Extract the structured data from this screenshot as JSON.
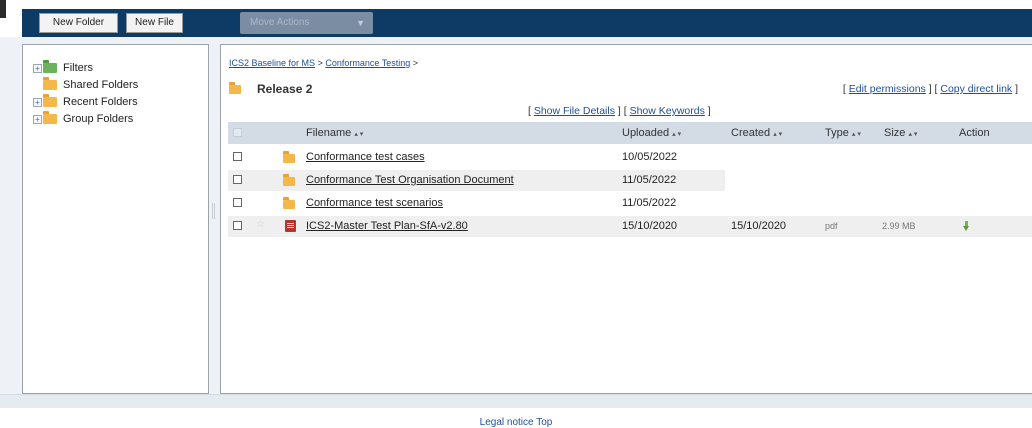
{
  "toolbar": {
    "new_folder": "New Folder",
    "new_file": "New File",
    "move_actions": "Move Actions"
  },
  "sidebar": {
    "items": [
      {
        "label": "Filters",
        "expandable": true,
        "icon": "folder-green-icon"
      },
      {
        "label": "Shared Folders",
        "expandable": false,
        "icon": "folder-icon"
      },
      {
        "label": "Recent Folders",
        "expandable": true,
        "icon": "folder-icon"
      },
      {
        "label": "Group Folders",
        "expandable": true,
        "icon": "folder-icon"
      }
    ]
  },
  "breadcrumb": {
    "items": [
      "ICS2 Baseline for MS",
      "Conformance Testing"
    ],
    "separator": ">"
  },
  "folder": {
    "title": "Release 2"
  },
  "links": {
    "edit_permissions": "Edit permissions",
    "copy_direct_link": "Copy direct link",
    "show_file_details": "Show File Details",
    "show_keywords": "Show Keywords"
  },
  "table": {
    "columns": [
      "Filename",
      "Uploaded",
      "Created",
      "Type",
      "Size",
      "Action"
    ],
    "rows": [
      {
        "name": "Conformance test cases",
        "uploaded": "10/05/2022",
        "created": "",
        "type": "",
        "size": "",
        "kind": "folder"
      },
      {
        "name": "Conformance Test Organisation Document",
        "uploaded": "11/05/2022",
        "created": "",
        "type": "",
        "size": "",
        "kind": "folder"
      },
      {
        "name": "Conformance test scenarios",
        "uploaded": "11/05/2022",
        "created": "",
        "type": "",
        "size": "",
        "kind": "folder"
      },
      {
        "name": "ICS2-Master Test Plan-SfA-v2.80",
        "uploaded": "15/10/2020",
        "created": "15/10/2020",
        "type": "pdf",
        "size": "2.99 MB",
        "kind": "pdf"
      }
    ]
  },
  "footer": {
    "legal": "Legal notice",
    "top": "Top"
  },
  "colors": {
    "header": "#0e3a66",
    "table_header": "#d3dbe5",
    "link": "#1f4f9c"
  }
}
